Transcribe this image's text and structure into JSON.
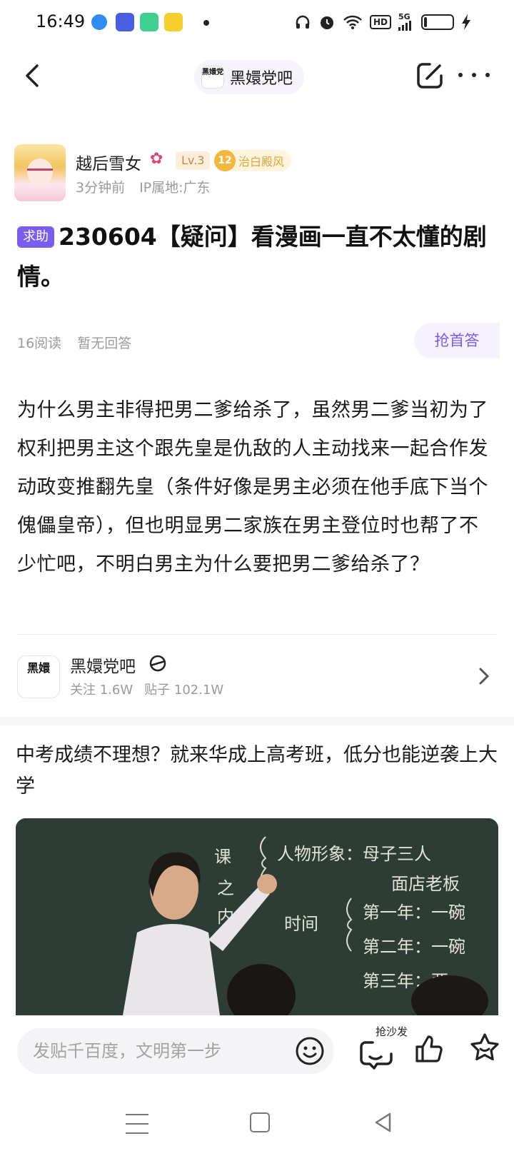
{
  "status_bar": {
    "time": "16:49",
    "network": "5G",
    "hd": "HD",
    "app_icons": [
      "location-app-icon",
      "notification-app-icon",
      "chat-app-icon",
      "kuaishou-app-icon"
    ]
  },
  "header": {
    "forum_name": "黑嬛党吧",
    "forum_avatar_text": "黑嬛党"
  },
  "author": {
    "name": "越后雪女",
    "level": "Lv.3",
    "title_level": "12",
    "title": "治白殿风",
    "time": "3分钟前",
    "ip": "IP属地:广东"
  },
  "post": {
    "tag": "求助",
    "title": "230604【疑问】看漫画一直不太懂的剧情。",
    "reads": "16阅读",
    "replies": "暂无回答",
    "first_reply_button": "抢首答",
    "body": "为什么男主非得把男二爹给杀了，虽然男二爹当初为了权利把男主这个跟先皇是仇敌的人主动找来一起合作发动政变推翻先皇（条件好像是男主必须在他手底下当个傀儡皇帝），但也明显男二家族在男主登位时也帮了不少忙吧，不明白男主为什么要把男二爹给杀了？"
  },
  "forum_card": {
    "name": "黑嬛党吧",
    "avatar_text": "黑嬛",
    "followers": "关注 1.6W",
    "posts": "贴子 102.1W"
  },
  "ad": {
    "title": "中考成绩不理想？就来华成上高考班，低分也能逆袭上大学",
    "board_lines": [
      "课",
      "之",
      "内",
      "人物形象：母子三人",
      "面店老板",
      "时间",
      "第一年：一碗",
      "第二年：一碗",
      "第三年：两"
    ]
  },
  "bottom_bar": {
    "input_placeholder": "发贴千百度，文明第一步",
    "sofa_label": "抢沙发"
  },
  "colors": {
    "accent": "#7a5cf0",
    "gold": "#e2a43c",
    "muted": "#9a9a9a"
  }
}
